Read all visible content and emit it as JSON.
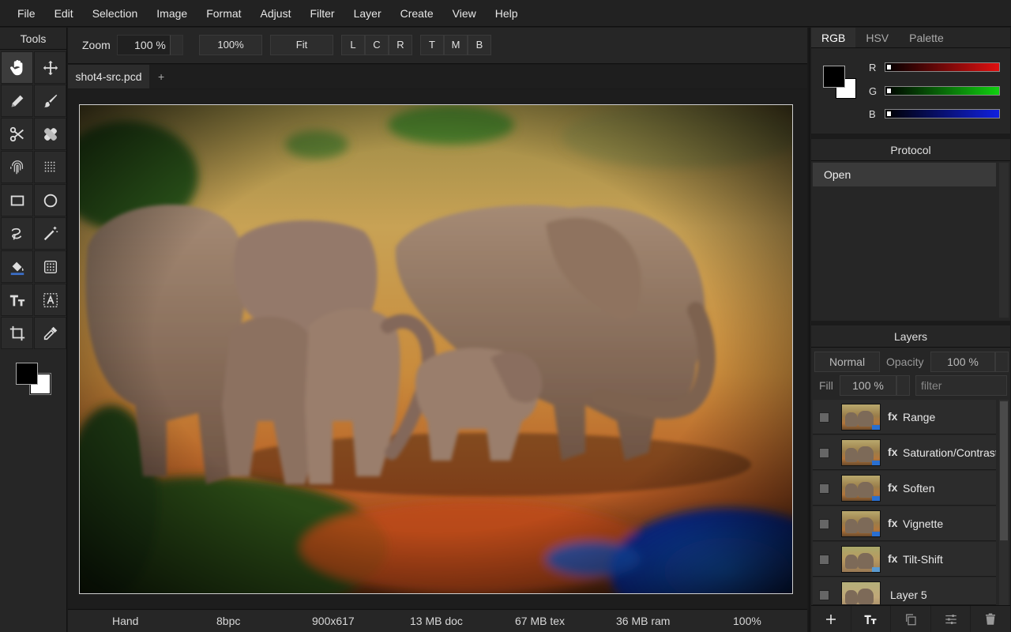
{
  "menu": [
    "File",
    "Edit",
    "Selection",
    "Image",
    "Format",
    "Adjust",
    "Filter",
    "Layer",
    "Create",
    "View",
    "Help"
  ],
  "tools": {
    "title": "Tools",
    "items": [
      "hand-icon",
      "move-icon",
      "pencil-icon",
      "brush-icon",
      "scissors-icon",
      "healing-icon",
      "fingerprint-icon",
      "dots-pattern-icon",
      "rectangle-icon",
      "ellipse-icon",
      "lasso-icon",
      "magic-wand-icon",
      "paint-bucket-icon",
      "gradient-icon",
      "text-icon",
      "text-box-icon",
      "crop-icon",
      "eyedropper-icon"
    ],
    "active": "hand-icon",
    "foreground_color": "#000000",
    "background_color": "#ffffff"
  },
  "toolbar": {
    "zoom_label": "Zoom",
    "zoom_value": "100 %",
    "btn_100": "100%",
    "btn_fit": "Fit",
    "align_h": [
      "L",
      "C",
      "R"
    ],
    "align_v": [
      "T",
      "M",
      "B"
    ]
  },
  "tabs": {
    "document": "shot4-src.pcd",
    "add": "+"
  },
  "status": {
    "tool": "Hand",
    "depth": "8bpc",
    "dimensions": "900x617",
    "doc_mem": "13 MB doc",
    "tex_mem": "67 MB tex",
    "ram": "36 MB ram",
    "zoom": "100%"
  },
  "color_panel": {
    "tabs": [
      "RGB",
      "HSV",
      "Palette"
    ],
    "active_tab": "RGB",
    "channels": [
      {
        "label": "R",
        "value": 0,
        "color": "#e01010"
      },
      {
        "label": "G",
        "value": 0,
        "color": "#10d010"
      },
      {
        "label": "B",
        "value": 0,
        "color": "#1020e0"
      }
    ]
  },
  "protocol": {
    "title": "Protocol",
    "items": [
      "Open"
    ]
  },
  "layers": {
    "title": "Layers",
    "blend_mode": "Normal",
    "opacity_label": "Opacity",
    "opacity_value": "100 %",
    "fill_label": "Fill",
    "fill_value": "100 %",
    "filter_placeholder": "filter",
    "items": [
      {
        "fx": "fx",
        "name": "Range"
      },
      {
        "fx": "fx",
        "name": "Saturation/Contrast"
      },
      {
        "fx": "fx",
        "name": "Soften"
      },
      {
        "fx": "fx",
        "name": "Vignette"
      },
      {
        "fx": "fx",
        "name": "Tilt-Shift"
      },
      {
        "fx": "",
        "name": "Layer 5"
      }
    ]
  }
}
